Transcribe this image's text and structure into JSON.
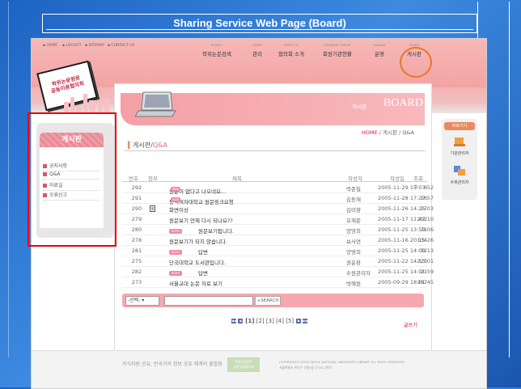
{
  "banner_title": "Sharing Service Web Page (Board)",
  "util_links": [
    "HOME",
    "LOGOUT",
    "SITEMAP",
    "CONTACT US"
  ],
  "menu": [
    {
      "en": "SEARCH",
      "ko": "학위논문검색"
    },
    {
      "en": "ADMIN",
      "ko": "관리"
    },
    {
      "en": "ABOUT US",
      "ko": "협의회 소개"
    },
    {
      "en": "MEMBERS' STATUS",
      "ko": "회원기관현황"
    },
    {
      "en": "MANAGE",
      "ko": "운영"
    },
    {
      "en": "BOARD",
      "ko": "게시판"
    }
  ],
  "logo_text": [
    "학위논문원문",
    "공동이용협의회"
  ],
  "sidebar": {
    "title": "게시판",
    "items": [
      "공지사항",
      "Q&A",
      "자료실",
      "오류신고"
    ]
  },
  "board_banner": {
    "label": "게시판",
    "title": "BOARD"
  },
  "breadcrumb": {
    "home": "HOME",
    "rest": " / 게시판 / Q&A"
  },
  "page_heading": {
    "prefix": "게시판/",
    "highlight": "Q&A"
  },
  "table": {
    "headers": [
      "번호",
      "첨부",
      "제목",
      "작성자",
      "작성일",
      "조회수"
    ],
    "rows": [
      {
        "no": "292",
        "file": "",
        "reply": false,
        "title": "원문이 없다고 나오네요...",
        "new": true,
        "author": "박준필",
        "date": "2005-11-29 15:03:52",
        "views": "6"
      },
      {
        "no": "291",
        "file": "",
        "reply": false,
        "title": "동덕여자대학교 원문링크요청",
        "new": true,
        "author": "김동재",
        "date": "2005-11-28 17:27:57",
        "views": "16"
      },
      {
        "no": "290",
        "file": "file",
        "reply": false,
        "title": "화면이상",
        "new": false,
        "author": "김미향",
        "date": "2005-11-26 14:25:03",
        "views": "27"
      },
      {
        "no": "279",
        "file": "",
        "reply": false,
        "title": "원문보기 언제 다시 되나요??",
        "new": false,
        "author": "유재준",
        "date": "2005-11-17 11:42:10",
        "views": "202"
      },
      {
        "no": "280",
        "file": "",
        "reply": true,
        "title": "원문보기됩니다.",
        "new": false,
        "author": "양영희",
        "date": "2005-11-25 13:59:06",
        "views": "71"
      },
      {
        "no": "278",
        "file": "",
        "reply": false,
        "title": "원문보기가 되지 않습니다.",
        "new": false,
        "author": "보사연",
        "date": "2005-11-16 20:15:26",
        "views": "134"
      },
      {
        "no": "281",
        "file": "",
        "reply": true,
        "title": "답변",
        "new": false,
        "author": "양영희",
        "date": "2005-11-25 14:00:13",
        "views": "32"
      },
      {
        "no": "275",
        "file": "",
        "reply": false,
        "title": "단국대학교 도서관입니다.",
        "new": false,
        "author": "권운환",
        "date": "2005-11-22 14:13:01",
        "views": "223"
      },
      {
        "no": "282",
        "file": "",
        "reply": true,
        "title": "답변",
        "new": false,
        "author": "수원관리자",
        "date": "2005-11-25 14:01:59",
        "views": "21"
      },
      {
        "no": "273",
        "file": "",
        "reply": false,
        "title": "서울교대 논문 자료 보기",
        "new": false,
        "author": "박혜원",
        "date": "2005-09-29 18:01:45",
        "views": "367"
      }
    ],
    "new_badge": "NEW",
    "reply_badge": "REPLY"
  },
  "search": {
    "select": "-선택-",
    "button": "+SEARCH"
  },
  "pager": {
    "pages": [
      "[1]",
      "[2]",
      "[3]",
      "[4]",
      "[5]"
    ]
  },
  "write_button": "글쓰기",
  "quick": {
    "title": "바로가기",
    "items": [
      "기관관리자",
      "수퍼관리자"
    ]
  },
  "footer": {
    "slogan": "지식자원 공유, 빈국가의 정보 공유 체계의 출발점",
    "logo": [
      "학위논문원문",
      "공동이용협의회"
    ],
    "copy": [
      "COPYRIGHT(C)2004 SEOUL NATIONAL UNIVERSITY LIBRARY ALL RIGHT RESERVED",
      "서울특별시 관악구 신림9동 산 56-1번지"
    ]
  },
  "colors": {
    "accent": "#f4a0a6",
    "board_circle": "#e87722",
    "highlight_box": "#ee0000",
    "desktop": "#2f7ad6"
  }
}
